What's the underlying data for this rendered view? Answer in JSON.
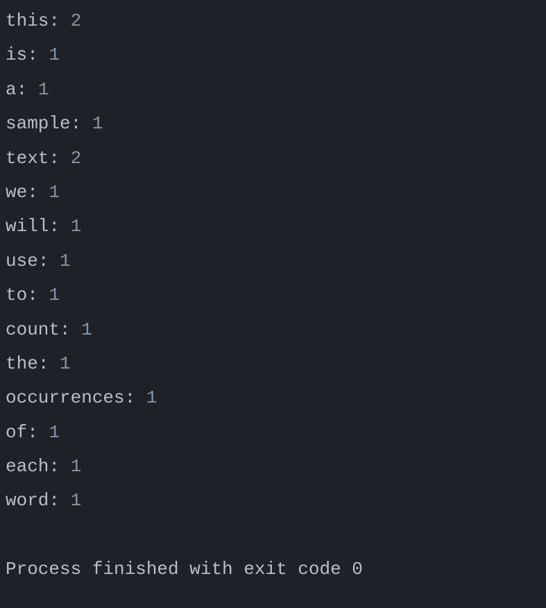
{
  "output_lines": [
    {
      "word": "this",
      "count": 2
    },
    {
      "word": "is",
      "count": 1
    },
    {
      "word": "a",
      "count": 1
    },
    {
      "word": "sample",
      "count": 1
    },
    {
      "word": "text",
      "count": 2
    },
    {
      "word": "we",
      "count": 1
    },
    {
      "word": "will",
      "count": 1
    },
    {
      "word": "use",
      "count": 1
    },
    {
      "word": "to",
      "count": 1
    },
    {
      "word": "count",
      "count": 1
    },
    {
      "word": "the",
      "count": 1
    },
    {
      "word": "occurrences",
      "count": 1
    },
    {
      "word": "of",
      "count": 1
    },
    {
      "word": "each",
      "count": 1
    },
    {
      "word": "word",
      "count": 1
    }
  ],
  "status_line": "Process finished with exit code 0"
}
